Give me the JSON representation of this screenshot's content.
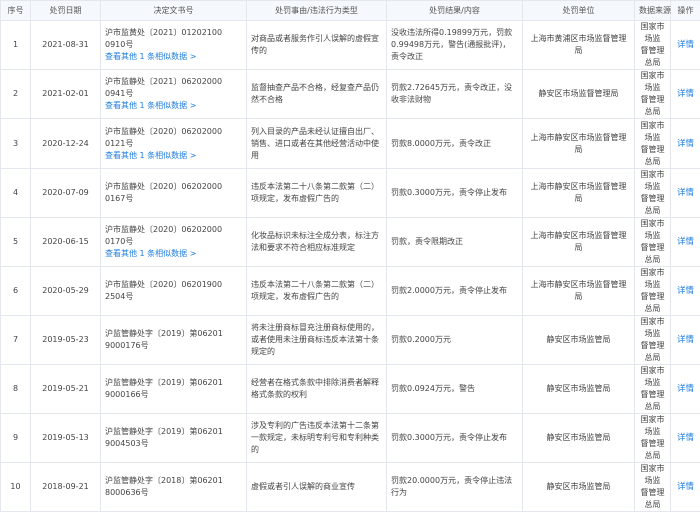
{
  "columns": [
    "序号",
    "处罚日期",
    "决定文书号",
    "处罚事由/违法行为类型",
    "处罚结果/内容",
    "处罚单位",
    "数据来源",
    "操作"
  ],
  "detail_label": "详情",
  "rows": [
    {
      "idx": "1",
      "date": "2021-08-31",
      "doc": [
        "沪市监黄处〔2021〕01202100",
        "0910号"
      ],
      "related": "查看其他 1 条相似数据 >",
      "reason": "对商品或者服务作引人误解的虚假宣传的",
      "result": "没收违法所得0.19899万元，罚款0.99498万元，警告(通报批评)，责令改正",
      "unit": "上海市黄浦区市场监督管理局",
      "source": [
        "国家市场监",
        "督管理总局"
      ]
    },
    {
      "idx": "2",
      "date": "2021-02-01",
      "doc": [
        "沪市监静处〔2021〕06202000",
        "0941号"
      ],
      "related": "查看其他 1 条相似数据 >",
      "reason": "监督抽查产品不合格，经复查产品仍然不合格",
      "result": "罚款2.72645万元，责令改正，没收非法财物",
      "unit": "静安区市场监督管理局",
      "source": [
        "国家市场监",
        "督管理总局"
      ]
    },
    {
      "idx": "3",
      "date": "2020-12-24",
      "doc": [
        "沪市监静处〔2020〕06202000",
        "0121号"
      ],
      "related": "查看其他 1 条相似数据 >",
      "reason": "列入目录的产品未经认证擅自出厂、销售、进口或者在其他经营活动中使用",
      "result": "罚款8.0000万元，责令改正",
      "unit": "上海市静安区市场监督管理局",
      "source": [
        "国家市场监",
        "督管理总局"
      ]
    },
    {
      "idx": "4",
      "date": "2020-07-09",
      "doc": [
        "沪市监静处〔2020〕06202000",
        "0167号"
      ],
      "related": "",
      "reason": "违反本法第二十八条第二款第（二）项规定，发布虚假广告的",
      "result": "罚款0.3000万元，责令停止发布",
      "unit": "上海市静安区市场监督管理局",
      "source": [
        "国家市场监",
        "督管理总局"
      ]
    },
    {
      "idx": "5",
      "date": "2020-06-15",
      "doc": [
        "沪市监静处〔2020〕06202000",
        "0170号"
      ],
      "related": "查看其他 1 条相似数据 >",
      "reason": "化妆品标识未标注全成分表，标注方法和要求不符合相应标准规定",
      "result": "罚款，责令限期改正",
      "unit": "上海市静安区市场监督管理局",
      "source": [
        "国家市场监",
        "督管理总局"
      ]
    },
    {
      "idx": "6",
      "date": "2020-05-29",
      "doc": [
        "沪市监静处〔2020〕06201900",
        "2504号"
      ],
      "related": "",
      "reason": "违反本法第二十八条第二款第（二）项规定，发布虚假广告的",
      "result": "罚款2.0000万元，责令停止发布",
      "unit": "上海市静安区市场监督管理局",
      "source": [
        "国家市场监",
        "督管理总局"
      ]
    },
    {
      "idx": "7",
      "date": "2019-05-23",
      "doc": [
        "沪监管静处字〔2019〕第06201",
        "9000176号"
      ],
      "related": "",
      "reason": "将未注册商标冒充注册商标使用的，或者使用未注册商标违反本法第十条规定的",
      "result": "罚款0.2000万元",
      "unit": "静安区市场监管局",
      "source": [
        "国家市场监",
        "督管理总局"
      ]
    },
    {
      "idx": "8",
      "date": "2019-05-21",
      "doc": [
        "沪监管静处字〔2019〕第06201",
        "9000166号"
      ],
      "related": "",
      "reason": "经营者在格式条款中排除消费者解释格式条款的权利",
      "result": "罚款0.0924万元，警告",
      "unit": "静安区市场监管局",
      "source": [
        "国家市场监",
        "督管理总局"
      ]
    },
    {
      "idx": "9",
      "date": "2019-05-13",
      "doc": [
        "沪监管静处字〔2019〕第06201",
        "9004503号"
      ],
      "related": "",
      "reason": "涉及专利的广告违反本法第十二条第一款规定，未标明专利号和专利种类的",
      "result": "罚款0.3000万元，责令停止发布",
      "unit": "静安区市场监管局",
      "source": [
        "国家市场监",
        "督管理总局"
      ]
    },
    {
      "idx": "10",
      "date": "2018-09-21",
      "doc": [
        "沪监管静处字〔2018〕第06201",
        "8000636号"
      ],
      "related": "",
      "reason": "虚假或者引人误解的商业宣传",
      "result": "罚款20.0000万元，责令停止违法行为",
      "unit": "静安区市场监管局",
      "source": [
        "国家市场监",
        "督管理总局"
      ]
    }
  ]
}
